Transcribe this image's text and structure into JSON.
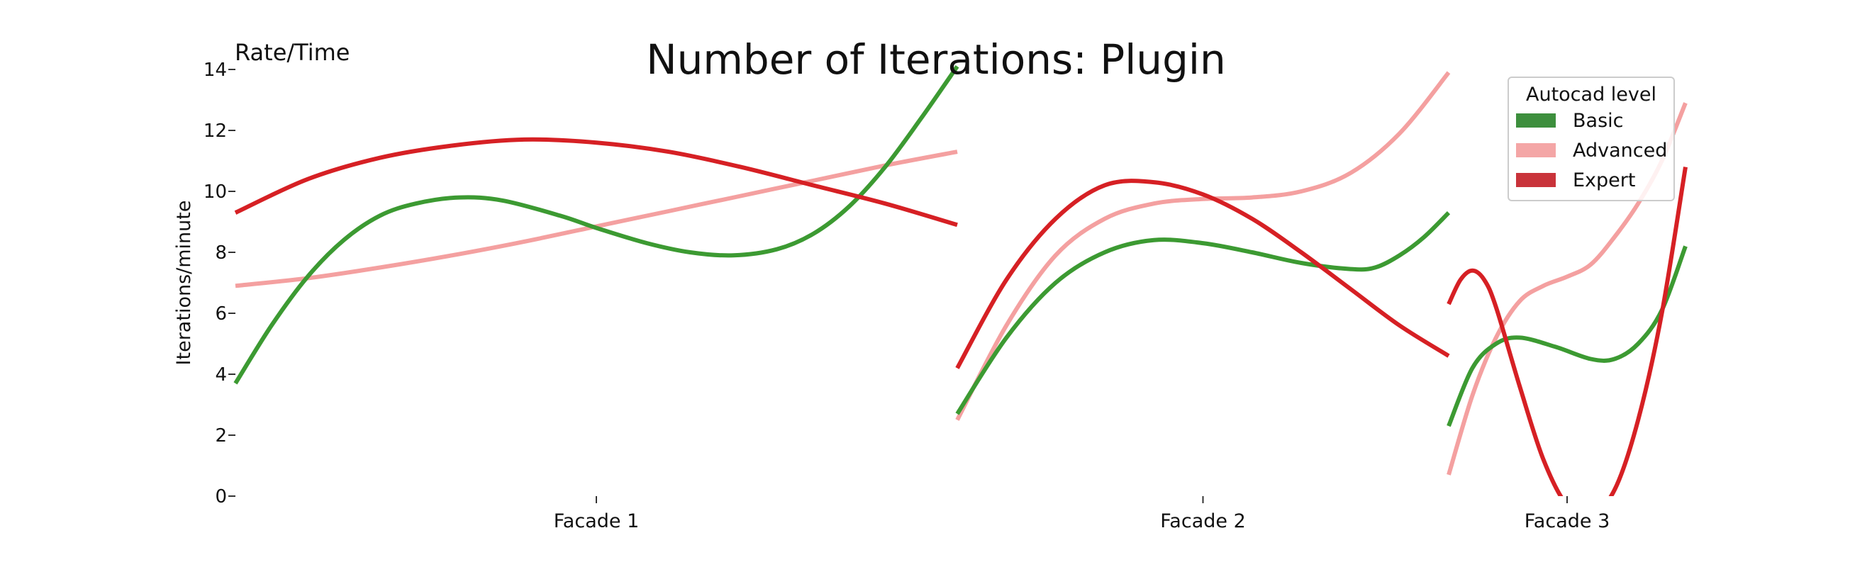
{
  "title": "Number of Iterations: Plugin",
  "corner_note": "Rate/Time",
  "legend": {
    "title": "Autocad level",
    "items": [
      {
        "label": "Basic",
        "color": "#3d8f3d"
      },
      {
        "label": "Advanced",
        "color": "#f4a6a6"
      },
      {
        "label": "Expert",
        "color": "#c9333a"
      }
    ]
  },
  "chart_data": {
    "type": "line",
    "title": "Number of Iterations: Plugin",
    "ylabel": "Iterations/minute",
    "xlabel": "",
    "ylim": [
      0,
      14
    ],
    "yticks": [
      0,
      2,
      4,
      6,
      8,
      10,
      12,
      14
    ],
    "categories": [
      "Facade 1",
      "Facade 2",
      "Facade 3"
    ],
    "grid": false,
    "legend_position": "top-right",
    "panels": [
      {
        "category": "Facade 1",
        "series": [
          {
            "name": "Basic",
            "color": "#3c9a32",
            "points": [
              [
                0,
                3.7
              ],
              [
                0.05,
                5.6
              ],
              [
                0.1,
                7.2
              ],
              [
                0.15,
                8.4
              ],
              [
                0.2,
                9.2
              ],
              [
                0.25,
                9.6
              ],
              [
                0.31,
                9.8
              ],
              [
                0.37,
                9.7
              ],
              [
                0.45,
                9.2
              ],
              [
                0.5,
                8.8
              ],
              [
                0.57,
                8.3
              ],
              [
                0.63,
                8.0
              ],
              [
                0.69,
                7.9
              ],
              [
                0.75,
                8.1
              ],
              [
                0.8,
                8.6
              ],
              [
                0.85,
                9.5
              ],
              [
                0.9,
                10.8
              ],
              [
                0.95,
                12.4
              ],
              [
                1,
                14.1
              ]
            ]
          },
          {
            "name": "Advanced",
            "color": "#f4a0a0",
            "points": [
              [
                0,
                6.9
              ],
              [
                0.1,
                7.15
              ],
              [
                0.2,
                7.5
              ],
              [
                0.3,
                7.9
              ],
              [
                0.4,
                8.35
              ],
              [
                0.5,
                8.85
              ],
              [
                0.6,
                9.35
              ],
              [
                0.7,
                9.85
              ],
              [
                0.8,
                10.35
              ],
              [
                0.9,
                10.85
              ],
              [
                1,
                11.3
              ]
            ]
          },
          {
            "name": "Expert",
            "color": "#d62024",
            "points": [
              [
                0,
                9.3
              ],
              [
                0.1,
                10.4
              ],
              [
                0.2,
                11.1
              ],
              [
                0.3,
                11.5
              ],
              [
                0.4,
                11.7
              ],
              [
                0.5,
                11.6
              ],
              [
                0.6,
                11.3
              ],
              [
                0.7,
                10.8
              ],
              [
                0.8,
                10.2
              ],
              [
                0.9,
                9.6
              ],
              [
                1,
                8.9
              ]
            ]
          }
        ]
      },
      {
        "category": "Facade 2",
        "series": [
          {
            "name": "Basic",
            "color": "#3c9a32",
            "points": [
              [
                0,
                2.7
              ],
              [
                0.1,
                5.2
              ],
              [
                0.2,
                7.0
              ],
              [
                0.3,
                8.0
              ],
              [
                0.4,
                8.4
              ],
              [
                0.5,
                8.3
              ],
              [
                0.6,
                8.0
              ],
              [
                0.7,
                7.65
              ],
              [
                0.8,
                7.45
              ],
              [
                0.85,
                7.5
              ],
              [
                0.9,
                7.9
              ],
              [
                0.95,
                8.5
              ],
              [
                1,
                9.3
              ]
            ]
          },
          {
            "name": "Advanced",
            "color": "#f4a0a0",
            "points": [
              [
                0,
                2.5
              ],
              [
                0.1,
                5.6
              ],
              [
                0.2,
                7.9
              ],
              [
                0.3,
                9.1
              ],
              [
                0.4,
                9.6
              ],
              [
                0.5,
                9.75
              ],
              [
                0.6,
                9.8
              ],
              [
                0.7,
                10.0
              ],
              [
                0.8,
                10.6
              ],
              [
                0.9,
                11.9
              ],
              [
                1,
                13.9
              ]
            ]
          },
          {
            "name": "Expert",
            "color": "#d62024",
            "points": [
              [
                0,
                4.2
              ],
              [
                0.1,
                7.1
              ],
              [
                0.2,
                9.1
              ],
              [
                0.3,
                10.2
              ],
              [
                0.4,
                10.3
              ],
              [
                0.5,
                9.9
              ],
              [
                0.6,
                9.1
              ],
              [
                0.7,
                8.0
              ],
              [
                0.8,
                6.8
              ],
              [
                0.9,
                5.6
              ],
              [
                1,
                4.6
              ]
            ]
          }
        ]
      },
      {
        "category": "Facade 3",
        "series": [
          {
            "name": "Basic",
            "color": "#3c9a32",
            "points": [
              [
                0,
                2.3
              ],
              [
                0.1,
                4.2
              ],
              [
                0.2,
                5.0
              ],
              [
                0.3,
                5.2
              ],
              [
                0.45,
                4.9
              ],
              [
                0.6,
                4.5
              ],
              [
                0.7,
                4.5
              ],
              [
                0.8,
                5.0
              ],
              [
                0.9,
                6.1
              ],
              [
                1,
                8.2
              ]
            ]
          },
          {
            "name": "Advanced",
            "color": "#f4a0a0",
            "points": [
              [
                0,
                0.7
              ],
              [
                0.1,
                3.3
              ],
              [
                0.2,
                5.2
              ],
              [
                0.3,
                6.4
              ],
              [
                0.4,
                6.9
              ],
              [
                0.5,
                7.2
              ],
              [
                0.6,
                7.6
              ],
              [
                0.7,
                8.5
              ],
              [
                0.8,
                9.6
              ],
              [
                0.9,
                11.0
              ],
              [
                1,
                12.9
              ]
            ]
          },
          {
            "name": "Expert",
            "color": "#d62024",
            "points": [
              [
                0,
                6.3
              ],
              [
                0.05,
                7.1
              ],
              [
                0.1,
                7.4
              ],
              [
                0.15,
                7.1
              ],
              [
                0.2,
                6.2
              ],
              [
                0.3,
                3.6
              ],
              [
                0.4,
                1.2
              ],
              [
                0.5,
                -0.3
              ],
              [
                0.6,
                -0.6
              ],
              [
                0.7,
                0.2
              ],
              [
                0.8,
                2.5
              ],
              [
                0.9,
                6.0
              ],
              [
                1,
                10.8
              ]
            ]
          }
        ]
      }
    ]
  }
}
